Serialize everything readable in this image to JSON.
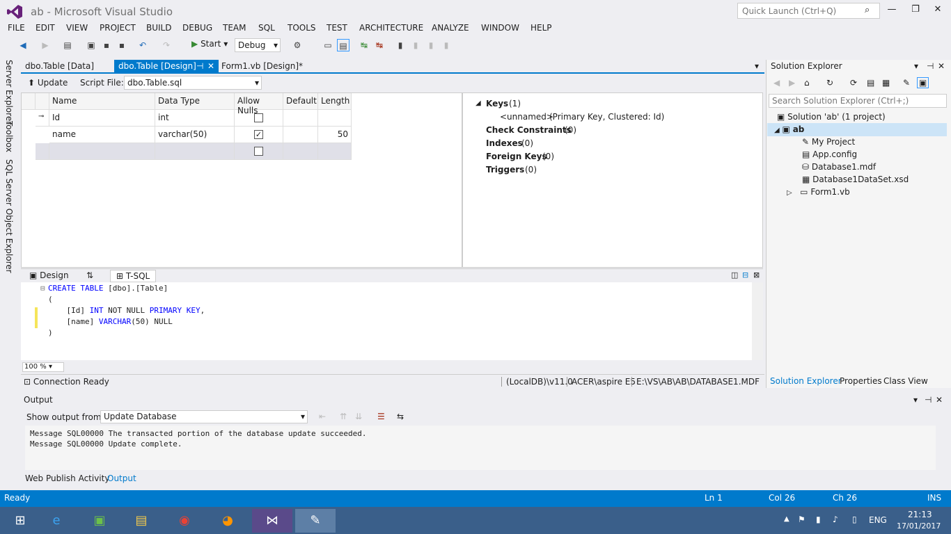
{
  "window": {
    "title": "ab - Microsoft Visual Studio",
    "quick_launch_placeholder": "Quick Launch (Ctrl+Q)"
  },
  "menu": [
    "FILE",
    "EDIT",
    "VIEW",
    "PROJECT",
    "BUILD",
    "DEBUG",
    "TEAM",
    "SQL",
    "TOOLS",
    "TEST",
    "ARCHITECTURE",
    "ANALYZE",
    "WINDOW",
    "HELP"
  ],
  "toolbar": {
    "start_label": "Start",
    "config_value": "Debug"
  },
  "left_tabs": [
    "Server Explorer",
    "Toolbox",
    "SQL Server Object Explorer"
  ],
  "doc_tabs": [
    "dbo.Table [Data]",
    "dbo.Table [Design]",
    "Form1.vb [Design]*"
  ],
  "designer": {
    "update_label": "Update",
    "script_file_label": "Script File:",
    "script_file_value": "dbo.Table.sql"
  },
  "grid": {
    "headers": [
      "Name",
      "Data Type",
      "Allow Nulls",
      "Default",
      "Length"
    ],
    "rows": [
      {
        "name": "Id",
        "type": "int",
        "allow_nulls": false,
        "default": "",
        "length": ""
      },
      {
        "name": "name",
        "type": "varchar(50)",
        "allow_nulls": true,
        "default": "",
        "length": "50"
      }
    ]
  },
  "properties": {
    "keys_label": "Keys",
    "keys_count": "(1)",
    "key_detail_name": "<unnamed>",
    "key_detail_desc": "(Primary Key, Clustered: Id)",
    "check_label": "Check Constraints",
    "check_count": "(0)",
    "indexes_label": "Indexes",
    "indexes_count": "(0)",
    "fk_label": "Foreign Keys",
    "fk_count": "(0)",
    "triggers_label": "Triggers",
    "triggers_count": "(0)"
  },
  "pane_tabs": {
    "design": "Design",
    "tsql": "T-SQL"
  },
  "code": {
    "line1_kw": "CREATE TABLE",
    "line1_rest": " [dbo].[Table]",
    "line2": "(",
    "line3_a": "    [Id] ",
    "line3_kw1": "INT",
    "line3_b": " NOT NULL ",
    "line3_kw2": "PRIMARY KEY",
    "line3_c": ",",
    "line4_a": "    [name] ",
    "line4_kw": "VARCHAR",
    "line4_b": "(50) NULL",
    "line5": ")"
  },
  "editor_zoom": "100 %",
  "connection": {
    "status": "Connection Ready",
    "server": "(LocalDB)\\v11.0",
    "user": "ACER\\aspire E5",
    "path": "E:\\VS\\AB\\AB\\DATABASE1.MDF"
  },
  "solution_explorer": {
    "title": "Solution Explorer",
    "search_placeholder": "Search Solution Explorer (Ctrl+;)",
    "solution": "Solution 'ab' (1 project)",
    "project": "ab",
    "items": [
      "My Project",
      "App.config",
      "Database1.mdf",
      "Database1DataSet.xsd",
      "Form1.vb"
    ],
    "bottom_tabs": [
      "Solution Explorer",
      "Properties",
      "Class View"
    ]
  },
  "output": {
    "title": "Output",
    "show_from_label": "Show output from:",
    "show_from_value": "Update Database",
    "lines": [
      "Message SQL00000 The transacted portion of the database update succeeded.",
      "Message SQL00000 Update complete."
    ],
    "bottom_tabs": [
      "Web Publish Activity",
      "Output"
    ]
  },
  "status": {
    "left": "Ready",
    "ln": "Ln 1",
    "col": "Col 26",
    "ch": "Ch 26",
    "mode": "INS"
  },
  "taskbar": {
    "lang": "ENG",
    "time": "21:13",
    "date": "17/01/2017"
  },
  "colors": {
    "accent": "#007acc",
    "statusbar": "#007acc"
  }
}
